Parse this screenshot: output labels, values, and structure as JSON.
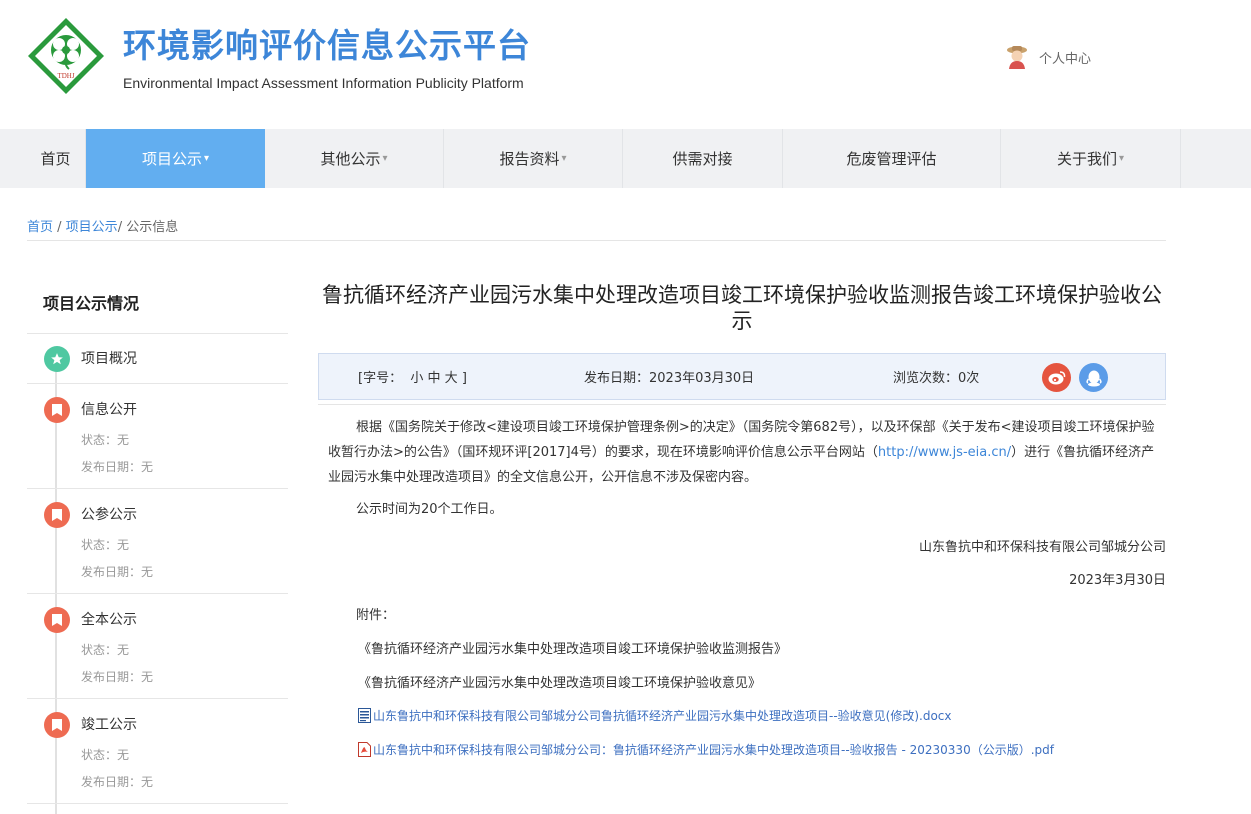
{
  "header": {
    "title": "环境影响评价信息公示平台",
    "subtitle": "Environmental Impact Assessment Information Publicity Platform",
    "logo_text": "TDHJ",
    "user_center": "个人中心"
  },
  "nav": {
    "items": [
      {
        "label": "首页",
        "has_caret": false
      },
      {
        "label": "项目公示",
        "has_caret": true,
        "active": true
      },
      {
        "label": "其他公示",
        "has_caret": true
      },
      {
        "label": "报告资料",
        "has_caret": true
      },
      {
        "label": "供需对接",
        "has_caret": false
      },
      {
        "label": "危废管理评估",
        "has_caret": false
      },
      {
        "label": "关于我们",
        "has_caret": true
      }
    ],
    "caret": "▾"
  },
  "breadcrumb": {
    "home": "首页",
    "sep1": " / ",
    "section": "项目公示",
    "sep2": "/ ",
    "current": "公示信息"
  },
  "sidebar": {
    "title": "项目公示情况",
    "items": [
      {
        "label": "项目概况",
        "icon": "star-icon"
      },
      {
        "label": "信息公开",
        "status": "状态：无",
        "date": "发布日期：无",
        "icon": "bookmark-icon"
      },
      {
        "label": "公参公示",
        "status": "状态：无",
        "date": "发布日期：无",
        "icon": "bookmark-icon"
      },
      {
        "label": "全本公示",
        "status": "状态：无",
        "date": "发布日期：无",
        "icon": "bookmark-icon"
      },
      {
        "label": "竣工公示",
        "status": "状态：无",
        "date": "发布日期：无",
        "icon": "bookmark-icon"
      }
    ]
  },
  "article": {
    "title": "鲁抗循环经济产业园污水集中处理改造项目竣工环境保护验收监测报告竣工环境保护验收公示",
    "font_size_prefix": "[字号：",
    "font_small": "小",
    "font_medium": "中",
    "font_large": "大",
    "font_size_suffix": "]",
    "publish_date": "发布日期：2023年03月30日",
    "views": "浏览次数：0次",
    "para1_a": "根据《国务院关于修改<建设项目竣工环境保护管理条例>的决定》（国务院令第682号），以及环保部《关于发布<建设项目竣工环境保护验收暂行办法>的公告》（国环规环评[2017]4号）的要求，现在环境影响评价信息公示平台网站（",
    "para1_link": "http://www.js-eia.cn/",
    "para1_b": "）进行《鲁抗循环经济产业园污水集中处理改造项目》的全文信息公开，公开信息不涉及保密内容。",
    "para2": "公示时间为20个工作日。",
    "signer": "山东鲁抗中和环保科技有限公司邹城分公司",
    "sign_date": "2023年3月30日",
    "attach_label": "附件：",
    "attach_titles": [
      "《鲁抗循环经济产业园污水集中处理改造项目竣工环境保护验收监测报告》",
      "《鲁抗循环经济产业园污水集中处理改造项目竣工环境保护验收意见》"
    ],
    "files": [
      {
        "name": "山东鲁抗中和环保科技有限公司邹城分公司鲁抗循环经济产业园污水集中处理改造项目--验收意见(修改).docx",
        "icon": "word-file-icon"
      },
      {
        "name": "山东鲁抗中和环保科技有限公司邹城分公司：鲁抗循环经济产业园污水集中处理改造项目--验收报告 - 20230330（公示版）.pdf",
        "icon": "pdf-file-icon"
      }
    ]
  },
  "colors": {
    "brand_blue": "#3d86d8",
    "nav_active": "#62aef0",
    "sidebar_green": "#4fc8a1",
    "sidebar_red": "#ee6b52"
  }
}
